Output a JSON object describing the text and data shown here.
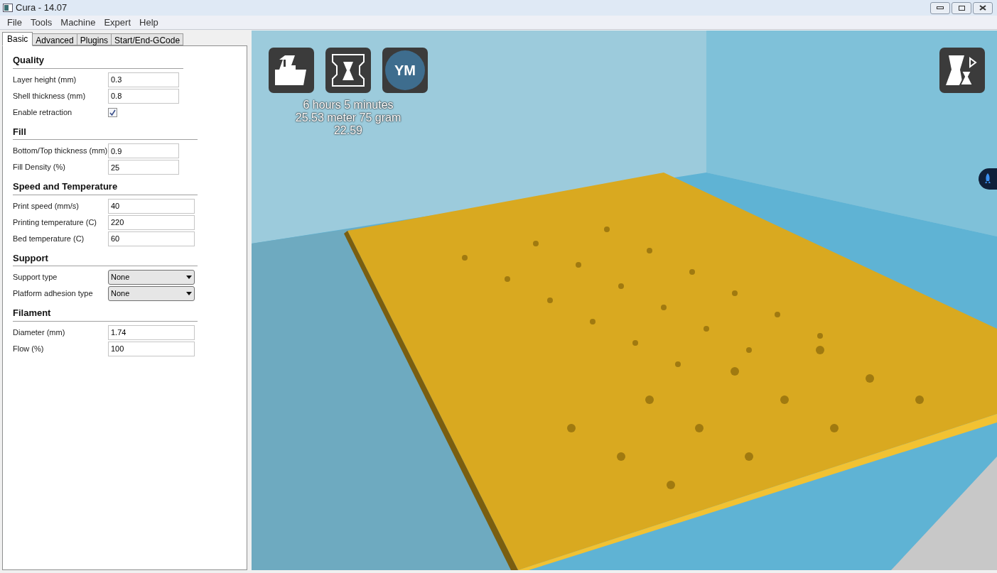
{
  "window": {
    "title": "Cura - 14.07"
  },
  "menu": [
    "File",
    "Tools",
    "Machine",
    "Expert",
    "Help"
  ],
  "tabs": [
    {
      "label": "Basic",
      "selected": true
    },
    {
      "label": "Advanced",
      "selected": false
    },
    {
      "label": "Plugins",
      "selected": false
    },
    {
      "label": "Start/End-GCode",
      "selected": false
    }
  ],
  "sections": [
    {
      "title": "Quality",
      "rows": [
        {
          "kind": "input",
          "label": "Layer height (mm)",
          "value": "0.3"
        },
        {
          "kind": "input",
          "label": "Shell thickness (mm)",
          "value": "0.8"
        },
        {
          "kind": "checkbox",
          "label": "Enable retraction",
          "checked": true
        }
      ]
    },
    {
      "title": "Fill",
      "rows": [
        {
          "kind": "input",
          "label": "Bottom/Top thickness (mm)",
          "value": "0.9"
        },
        {
          "kind": "input",
          "label": "Fill Density (%)",
          "value": "25"
        }
      ]
    },
    {
      "title": "Speed and Temperature",
      "rows": [
        {
          "kind": "input",
          "label": "Print speed (mm/s)",
          "value": "40"
        },
        {
          "kind": "input",
          "label": "Printing temperature (C)",
          "value": "220"
        },
        {
          "kind": "input",
          "label": "Bed temperature (C)",
          "value": "60"
        }
      ]
    },
    {
      "title": "Support",
      "rows": [
        {
          "kind": "select",
          "label": "Support type",
          "value": "None"
        },
        {
          "kind": "select",
          "label": "Platform adhesion type",
          "value": "None"
        }
      ]
    },
    {
      "title": "Filament",
      "rows": [
        {
          "kind": "input",
          "label": "Diameter (mm)",
          "value": "1.74"
        },
        {
          "kind": "input",
          "label": "Flow (%)",
          "value": "100"
        }
      ]
    }
  ],
  "viewport": {
    "toolbar_badge": "YM",
    "print_info": [
      "6 hours 5 minutes",
      "25.53 meter 75 gram",
      "22.59"
    ]
  }
}
